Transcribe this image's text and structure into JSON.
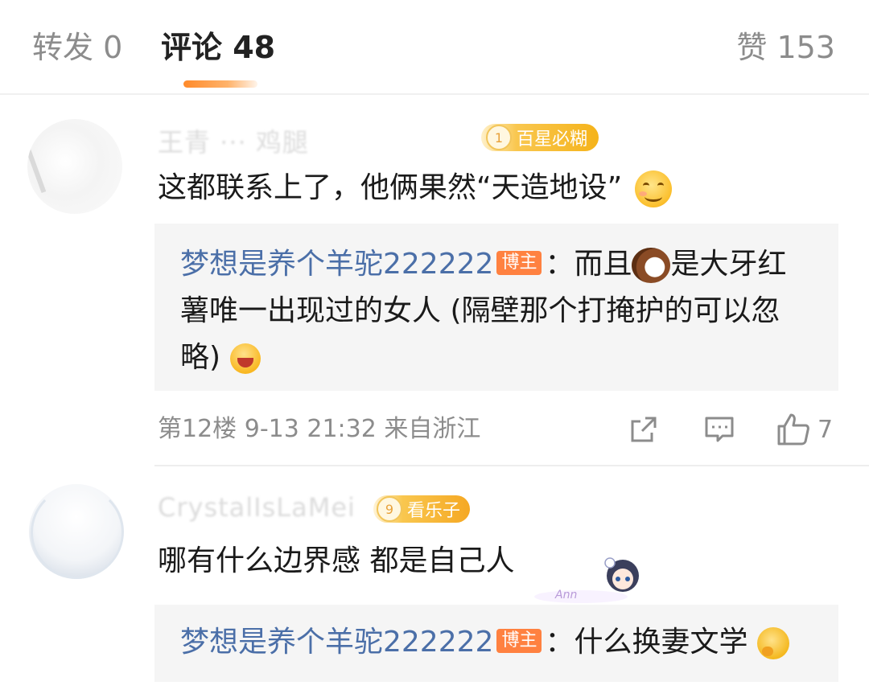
{
  "tabs": {
    "repost": "转发 0",
    "comment": "评论 48",
    "like": "赞 153"
  },
  "comments": [
    {
      "username": "王青 ··· 鸡腿",
      "badge_level": "1",
      "badge_text": "百星必糊",
      "text": "这都联系上了，他俩果然“天造地设”",
      "reply": {
        "user": "梦想是养个羊驼222222",
        "tag": "博主",
        "text_a": "：而且",
        "text_b": "是大牙红薯唯一出现过的女人 (隔壁那个打掩护的可以忽略)"
      },
      "floor": "第12楼",
      "time": "9-13 21:32",
      "location": "来自浙江",
      "likes": "7"
    },
    {
      "username": "CrystalIsLaMei",
      "badge_level": "9",
      "badge_text": "看乐子",
      "text": "哪有什么边界感 都是自己人",
      "reply": {
        "user": "梦想是养个羊驼222222",
        "tag": "博主",
        "text_a": "：什么换妻文学"
      }
    }
  ],
  "icons": {
    "share": "share-icon",
    "comment": "comment-icon",
    "like": "thumb-up-icon"
  },
  "colors": {
    "accent": "#ff8a2a",
    "link": "#4b6fa8",
    "blogger_tag": "#ff8140",
    "muted": "#8c8c8c"
  }
}
